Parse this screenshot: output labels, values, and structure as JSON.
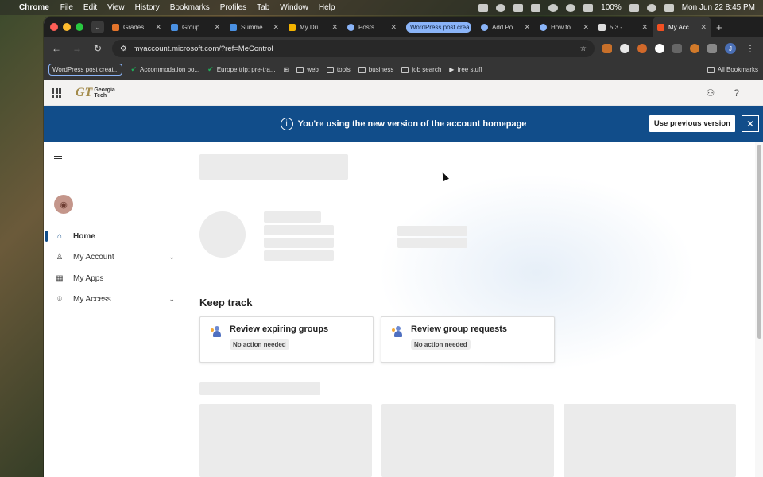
{
  "menubar": {
    "app_name": "Chrome",
    "menus": [
      "File",
      "Edit",
      "View",
      "History",
      "Bookmarks",
      "Profiles",
      "Tab",
      "Window",
      "Help"
    ],
    "battery": "100%",
    "clock": "Mon Jun 22  8:45 PM"
  },
  "tabs": [
    {
      "label": "Grades",
      "color": "#e3742b"
    },
    {
      "label": "Group",
      "color": "#4a90e2"
    },
    {
      "label": "Summe",
      "color": "#4a90e2"
    },
    {
      "label": "My Dri",
      "color": "#f4b400"
    },
    {
      "label": "Posts",
      "color": "#8ab4f8"
    },
    {
      "label": "WordPress post crea",
      "color": "#8ab4f8"
    },
    {
      "label": "Add Po",
      "color": "#8ab4f8"
    },
    {
      "label": "How to",
      "color": "#8ab4f8"
    },
    {
      "label": "5.3 - T",
      "color": "#dddddd"
    },
    {
      "label": "My Acc",
      "color": "#f25022"
    }
  ],
  "new_tab_label": "+",
  "omnibox": {
    "url": "myaccount.microsoft.com/?ref=MeControl"
  },
  "profile_initial": "J",
  "bookmarks": [
    {
      "label": "WordPress post creat...",
      "boxed": true
    },
    {
      "label": "Accommodation bo...",
      "check": true
    },
    {
      "label": "Europe trip: pre-tra...",
      "check": true
    },
    {
      "label": "web",
      "folder": true
    },
    {
      "label": "tools",
      "folder": true
    },
    {
      "label": "business",
      "folder": true
    },
    {
      "label": "job search",
      "folder": true
    },
    {
      "label": "free stuff"
    }
  ],
  "all_bookmarks": "All Bookmarks",
  "header": {
    "logo_mark": "GT",
    "logo_line1": "Georgia",
    "logo_line2": "Tech",
    "help": "?"
  },
  "banner": {
    "message": "You're using the new version of the account homepage",
    "prev_button": "Use previous version",
    "close": "✕",
    "info": "i"
  },
  "sidebar": {
    "items": [
      {
        "label": "Home",
        "icon": "⌂"
      },
      {
        "label": "My Account",
        "icon": "♙"
      },
      {
        "label": "My Apps",
        "icon": "▦"
      },
      {
        "label": "My Access",
        "icon": "⌾"
      }
    ]
  },
  "main": {
    "section_title": "Keep track",
    "cards": [
      {
        "title": "Review expiring groups",
        "badge": "No action needed"
      },
      {
        "title": "Review group requests",
        "badge": "No action needed"
      }
    ]
  },
  "colors": {
    "banner": "#114d8a",
    "accent": "#114d8a"
  }
}
